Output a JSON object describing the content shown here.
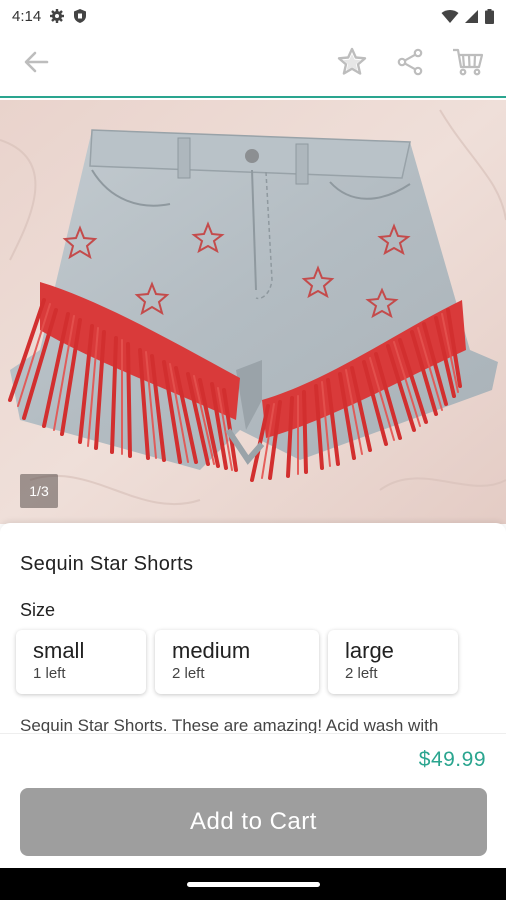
{
  "status_bar": {
    "time": "4:14"
  },
  "app_bar": {
    "back_icon": "arrow-left-icon",
    "favorite_icon": "star-icon",
    "share_icon": "share-icon",
    "cart_icon": "cart-icon"
  },
  "gallery": {
    "indicator": "1/3"
  },
  "product": {
    "title": "Sequin Star Shorts",
    "size_label": "Size",
    "sizes": [
      {
        "name": "small",
        "stock": "1 left"
      },
      {
        "name": "medium",
        "stock": "2 left"
      },
      {
        "name": "large",
        "stock": "2 left"
      }
    ],
    "description": "Sequin Star Shorts. These are amazing! Acid wash with",
    "price": "$49.99"
  },
  "footer": {
    "add_to_cart_label": "Add to Cart"
  },
  "colors": {
    "accent": "#2aa58f",
    "button_disabled": "#9e9e9e",
    "fringe": "#d93a3a"
  }
}
